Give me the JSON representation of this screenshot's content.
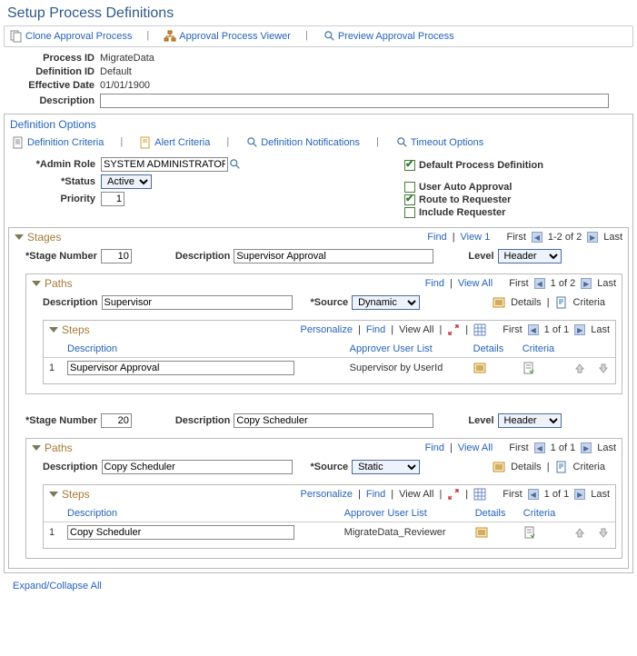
{
  "page_title": "Setup Process Definitions",
  "toolbar": {
    "clone": "Clone Approval Process",
    "viewer": "Approval Process Viewer",
    "preview": "Preview Approval Process"
  },
  "header": {
    "process_id_label": "Process ID",
    "process_id_value": "MigrateData",
    "definition_id_label": "Definition ID",
    "definition_id_value": "Default",
    "effective_date_label": "Effective Date",
    "effective_date_value": "01/01/1900",
    "description_label": "Description",
    "description_value": ""
  },
  "def_options": {
    "title": "Definition Options",
    "tabs": {
      "criteria": "Definition Criteria",
      "alert": "Alert Criteria",
      "notifications": "Definition Notifications",
      "timeout": "Timeout Options"
    },
    "admin_role_label": "Admin Role",
    "admin_role_value": "SYSTEM ADMINISTRATOR",
    "status_label": "Status",
    "status_value": "Active",
    "priority_label": "Priority",
    "priority_value": "1",
    "checks": {
      "default_process": "Default Process Definition",
      "user_auto": "User Auto Approval",
      "route_requester": "Route to Requester",
      "include_requester": "Include Requester"
    }
  },
  "stages_block": {
    "title": "Stages",
    "find": "Find",
    "viewx": "View 1",
    "first": "First",
    "pager": "1-2 of 2",
    "last": "Last",
    "stage_number_label": "Stage Number",
    "description_label": "Description",
    "level_label": "Level",
    "level_value": "Header"
  },
  "path_common": {
    "title": "Paths",
    "find": "Find",
    "view_all": "View All",
    "first": "First",
    "last": "Last",
    "desc_label": "Description",
    "source_label": "Source",
    "details": "Details",
    "criteria": "Criteria"
  },
  "steps_common": {
    "title": "Steps",
    "personalize": "Personalize",
    "find": "Find",
    "view_all": "View All",
    "first": "First",
    "last": "Last",
    "col_desc": "Description",
    "col_approver": "Approver User List",
    "col_details": "Details",
    "col_criteria": "Criteria"
  },
  "stages": [
    {
      "number": "10",
      "description": "Supervisor Approval",
      "path_pager": "1 of 2",
      "path_desc": "Supervisor",
      "source": "Dynamic",
      "step_pager": "1 of 1",
      "step_row_num": "1",
      "step_desc": "Supervisor Approval",
      "step_approver": "Supervisor by UserId"
    },
    {
      "number": "20",
      "description": "Copy Scheduler",
      "path_pager": "1 of 1",
      "path_desc": "Copy Scheduler",
      "source": "Static",
      "step_pager": "1 of 1",
      "step_row_num": "1",
      "step_desc": "Copy Scheduler",
      "step_approver": "MigrateData_Reviewer"
    }
  ],
  "footer": {
    "expand_collapse": "Expand/Collapse All"
  }
}
